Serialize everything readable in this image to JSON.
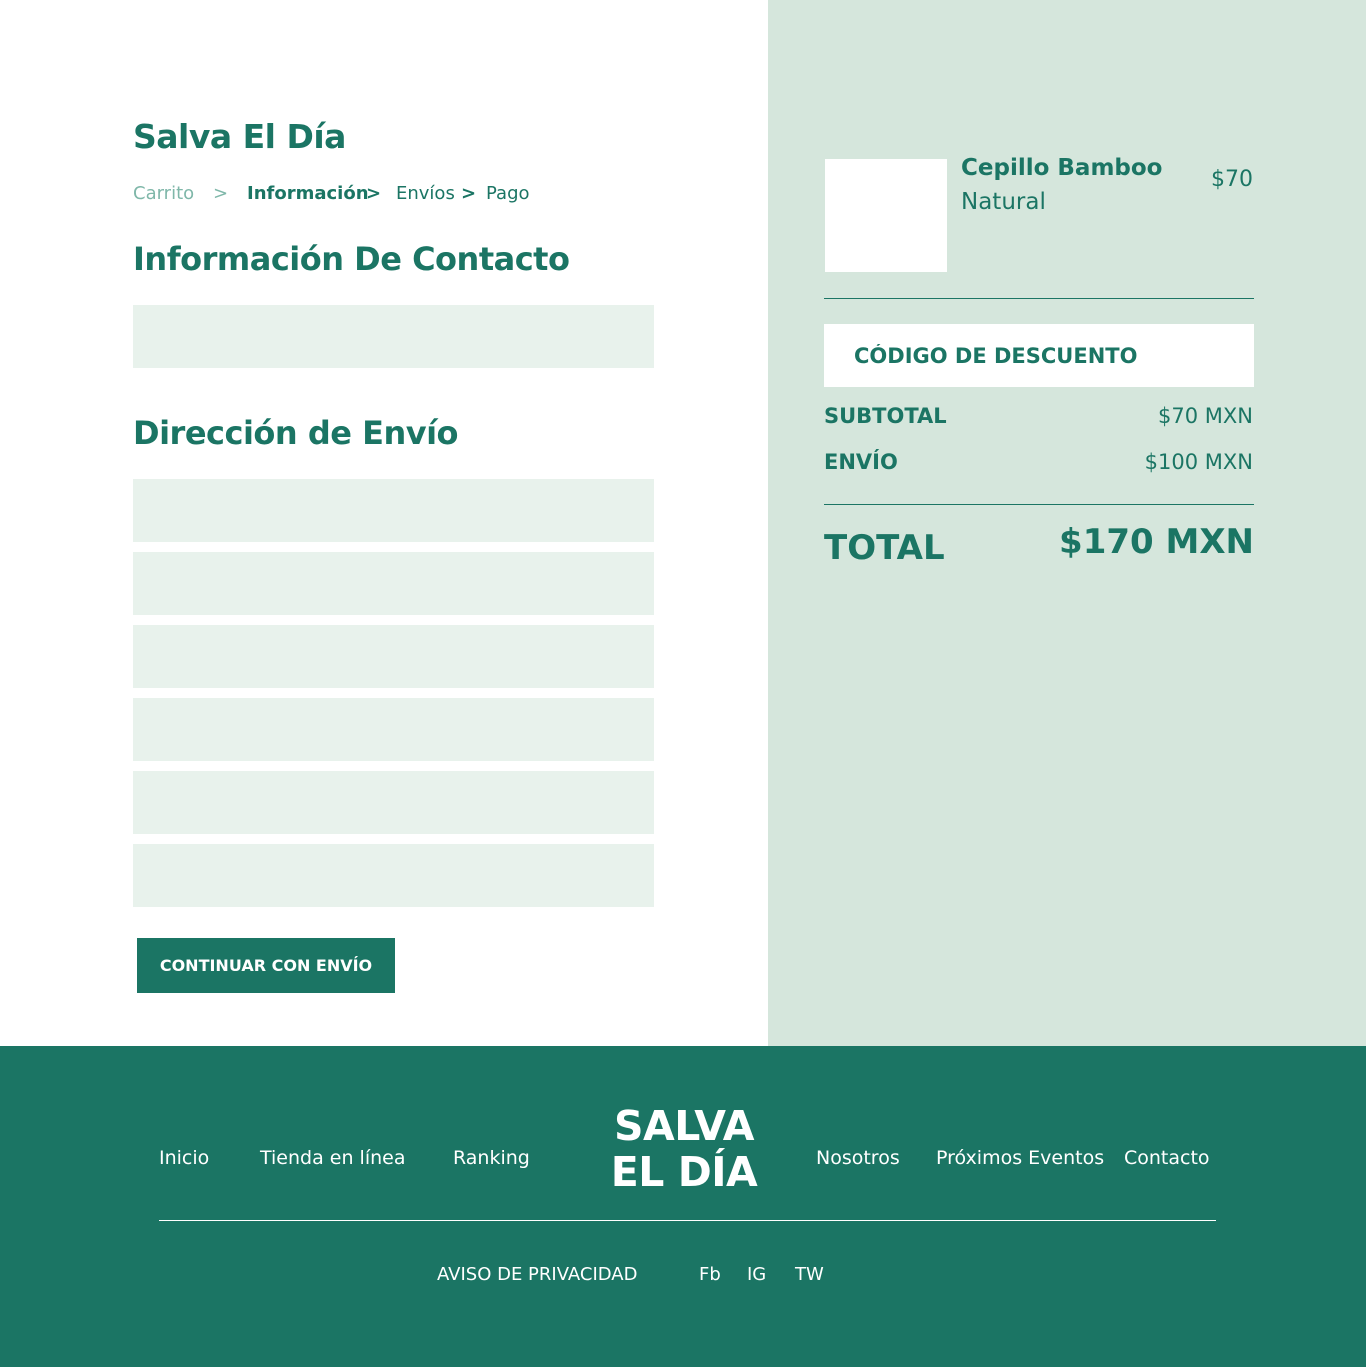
{
  "brand": "Salva El Día",
  "breadcrumb": {
    "items": [
      "Carrito",
      "Información",
      "Envíos",
      "Pago"
    ],
    "separator": ">"
  },
  "contact": {
    "title": "Información De Contacto",
    "field_placeholder": ""
  },
  "shipping": {
    "title": "Dirección de Envío",
    "fields": [
      "",
      "",
      "",
      "",
      "",
      ""
    ]
  },
  "continue_button": "CONTINUAR CON ENVÍO",
  "product": {
    "name": "Cepillo Bamboo",
    "variant": "Natural",
    "price": "$70"
  },
  "discount": {
    "placeholder": "CÓDIGO DE DESCUENTO"
  },
  "summary": {
    "subtotal_label": "SUBTOTAL",
    "subtotal_value": "$70 MXN",
    "shipping_label": "ENVÍO",
    "shipping_value": "$100 MXN",
    "total_label": "TOTAL",
    "total_value": "$170 MXN"
  },
  "footer": {
    "nav_left": [
      "Inicio",
      "Tienda en línea",
      "Ranking"
    ],
    "logo_lines": [
      "SALVA",
      "EL DÍA"
    ],
    "nav_right": [
      "Nosotros",
      "Próximos Eventos",
      "Contacto"
    ],
    "privacy": "AVISO DE PRIVACIDAD",
    "social": [
      "Fb",
      "IG",
      "TW"
    ]
  },
  "colors": {
    "primary": "#1b7564",
    "panel": "#d5e6dc",
    "field": "#e8f2ec",
    "muted": "#7fb7a9"
  }
}
